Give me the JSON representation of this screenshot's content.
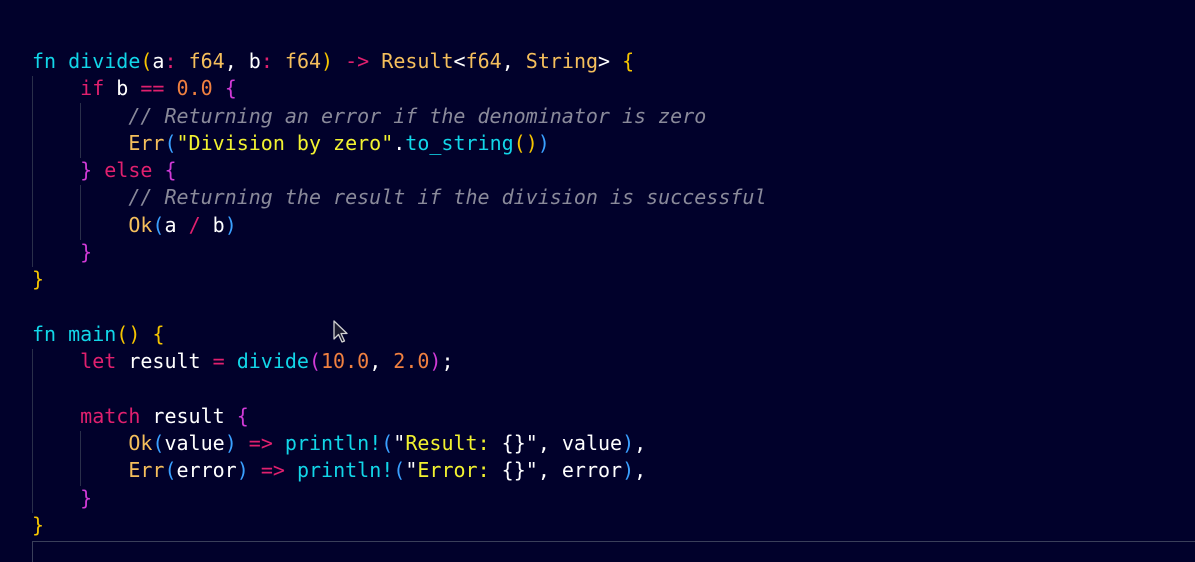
{
  "colors": {
    "background": "#01012b",
    "keyword": "#e0206e",
    "function": "#12d6e8",
    "type": "#f5bf5c",
    "string": "#f2f230",
    "comment": "#8a8a9a",
    "number": "#f08040",
    "bracket_yellow": "#f5c400",
    "bracket_magenta": "#d03ad6",
    "bracket_blue": "#3aa0ff",
    "plain": "#ffffff",
    "operator": "#e0206e"
  },
  "icons": {
    "cursor": "mouse-pointer-icon"
  },
  "lines": [
    [
      {
        "t": "fn ",
        "c": "function"
      },
      {
        "t": "divide",
        "c": "function"
      },
      {
        "t": "(",
        "c": "bracket_yellow"
      },
      {
        "t": "a",
        "c": "plain"
      },
      {
        "t": ": ",
        "c": "keyword"
      },
      {
        "t": "f64",
        "c": "type"
      },
      {
        "t": ", ",
        "c": "plain"
      },
      {
        "t": "b",
        "c": "plain"
      },
      {
        "t": ": ",
        "c": "keyword"
      },
      {
        "t": "f64",
        "c": "type"
      },
      {
        "t": ") ",
        "c": "bracket_yellow"
      },
      {
        "t": "->",
        "c": "keyword"
      },
      {
        "t": " ",
        "c": "plain"
      },
      {
        "t": "Result",
        "c": "type"
      },
      {
        "t": "<",
        "c": "plain"
      },
      {
        "t": "f64",
        "c": "type"
      },
      {
        "t": ", ",
        "c": "plain"
      },
      {
        "t": "String",
        "c": "type"
      },
      {
        "t": "> ",
        "c": "plain"
      },
      {
        "t": "{",
        "c": "bracket_yellow"
      }
    ],
    [
      {
        "t": "    ",
        "c": "plain"
      },
      {
        "t": "if",
        "c": "keyword"
      },
      {
        "t": " b ",
        "c": "plain"
      },
      {
        "t": "==",
        "c": "keyword"
      },
      {
        "t": " ",
        "c": "plain"
      },
      {
        "t": "0.0",
        "c": "number"
      },
      {
        "t": " ",
        "c": "plain"
      },
      {
        "t": "{",
        "c": "bracket_magenta"
      }
    ],
    [
      {
        "t": "        ",
        "c": "plain"
      },
      {
        "t": "// Returning an error if the denominator is zero",
        "c": "comment"
      }
    ],
    [
      {
        "t": "        ",
        "c": "plain"
      },
      {
        "t": "Err",
        "c": "type"
      },
      {
        "t": "(",
        "c": "bracket_blue"
      },
      {
        "t": "\"Division by zero\"",
        "c": "string"
      },
      {
        "t": ".",
        "c": "plain"
      },
      {
        "t": "to_string",
        "c": "function"
      },
      {
        "t": "()",
        "c": "bracket_yellow"
      },
      {
        "t": ")",
        "c": "bracket_blue"
      }
    ],
    [
      {
        "t": "    ",
        "c": "plain"
      },
      {
        "t": "}",
        "c": "bracket_magenta"
      },
      {
        "t": " ",
        "c": "plain"
      },
      {
        "t": "else",
        "c": "keyword"
      },
      {
        "t": " ",
        "c": "plain"
      },
      {
        "t": "{",
        "c": "bracket_magenta"
      }
    ],
    [
      {
        "t": "        ",
        "c": "plain"
      },
      {
        "t": "// Returning the result if the division is successful",
        "c": "comment"
      }
    ],
    [
      {
        "t": "        ",
        "c": "plain"
      },
      {
        "t": "Ok",
        "c": "type"
      },
      {
        "t": "(",
        "c": "bracket_blue"
      },
      {
        "t": "a ",
        "c": "plain"
      },
      {
        "t": "/",
        "c": "keyword"
      },
      {
        "t": " b",
        "c": "plain"
      },
      {
        "t": ")",
        "c": "bracket_blue"
      }
    ],
    [
      {
        "t": "    ",
        "c": "plain"
      },
      {
        "t": "}",
        "c": "bracket_magenta"
      }
    ],
    [
      {
        "t": "}",
        "c": "bracket_yellow"
      }
    ],
    [],
    [
      {
        "t": "fn ",
        "c": "function"
      },
      {
        "t": "main",
        "c": "function"
      },
      {
        "t": "()",
        "c": "bracket_yellow"
      },
      {
        "t": " ",
        "c": "plain"
      },
      {
        "t": "{",
        "c": "bracket_yellow"
      }
    ],
    [
      {
        "t": "    ",
        "c": "plain"
      },
      {
        "t": "let",
        "c": "keyword"
      },
      {
        "t": " result ",
        "c": "plain"
      },
      {
        "t": "=",
        "c": "keyword"
      },
      {
        "t": " ",
        "c": "plain"
      },
      {
        "t": "divide",
        "c": "function"
      },
      {
        "t": "(",
        "c": "bracket_magenta"
      },
      {
        "t": "10.0",
        "c": "number"
      },
      {
        "t": ", ",
        "c": "plain"
      },
      {
        "t": "2.0",
        "c": "number"
      },
      {
        "t": ")",
        "c": "bracket_magenta"
      },
      {
        "t": ";",
        "c": "plain"
      }
    ],
    [],
    [
      {
        "t": "    ",
        "c": "plain"
      },
      {
        "t": "match",
        "c": "keyword"
      },
      {
        "t": " result ",
        "c": "plain"
      },
      {
        "t": "{",
        "c": "bracket_magenta"
      }
    ],
    [
      {
        "t": "        ",
        "c": "plain"
      },
      {
        "t": "Ok",
        "c": "type"
      },
      {
        "t": "(",
        "c": "bracket_blue"
      },
      {
        "t": "value",
        "c": "plain"
      },
      {
        "t": ") ",
        "c": "bracket_blue"
      },
      {
        "t": "=>",
        "c": "keyword"
      },
      {
        "t": " ",
        "c": "plain"
      },
      {
        "t": "println!",
        "c": "function"
      },
      {
        "t": "(",
        "c": "bracket_blue"
      },
      {
        "t": "\"",
        "c": "plain"
      },
      {
        "t": "Result: ",
        "c": "string"
      },
      {
        "t": "{}",
        "c": "plain"
      },
      {
        "t": "\"",
        "c": "plain"
      },
      {
        "t": ", value",
        "c": "plain"
      },
      {
        "t": ")",
        "c": "bracket_blue"
      },
      {
        "t": ",",
        "c": "plain"
      }
    ],
    [
      {
        "t": "        ",
        "c": "plain"
      },
      {
        "t": "Err",
        "c": "type"
      },
      {
        "t": "(",
        "c": "bracket_blue"
      },
      {
        "t": "error",
        "c": "plain"
      },
      {
        "t": ") ",
        "c": "bracket_blue"
      },
      {
        "t": "=>",
        "c": "keyword"
      },
      {
        "t": " ",
        "c": "plain"
      },
      {
        "t": "println!",
        "c": "function"
      },
      {
        "t": "(",
        "c": "bracket_blue"
      },
      {
        "t": "\"",
        "c": "plain"
      },
      {
        "t": "Error: ",
        "c": "string"
      },
      {
        "t": "{}",
        "c": "plain"
      },
      {
        "t": "\"",
        "c": "plain"
      },
      {
        "t": ", error",
        "c": "plain"
      },
      {
        "t": ")",
        "c": "bracket_blue"
      },
      {
        "t": ",",
        "c": "plain"
      }
    ],
    [
      {
        "t": "    ",
        "c": "plain"
      },
      {
        "t": "}",
        "c": "bracket_magenta"
      }
    ],
    [
      {
        "t": "}",
        "c": "bracket_yellow"
      }
    ]
  ]
}
